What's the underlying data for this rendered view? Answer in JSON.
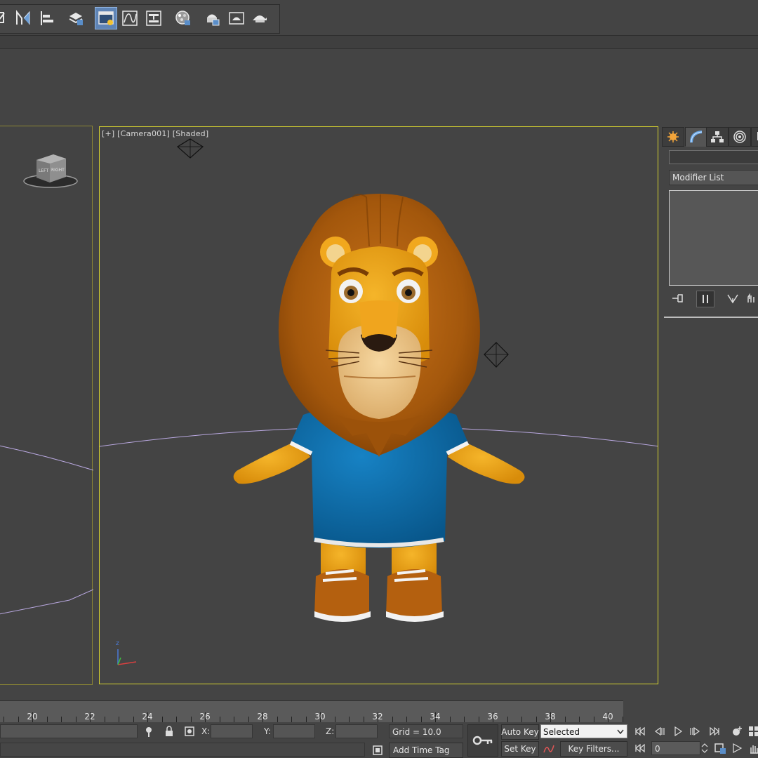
{
  "viewport": {
    "label": "[+] [Camera001] [Shaded]",
    "viewcube_left": "LEFT",
    "viewcube_right": "RIGHT"
  },
  "command_panel": {
    "tabs": [
      "create-icon",
      "modify-icon",
      "hierarchy-icon",
      "motion-icon",
      "display-icon"
    ],
    "modifier_list_label": "Modifier List"
  },
  "timeline": {
    "ticks": [
      "20",
      "22",
      "24",
      "26",
      "28",
      "30",
      "32",
      "34",
      "36",
      "38",
      "40"
    ]
  },
  "status_bar": {
    "x_label": "X:",
    "y_label": "Y:",
    "z_label": "Z:",
    "grid": "Grid = 10.0",
    "add_time_tag": "Add Time Tag",
    "auto_key": "Auto Key",
    "set_key": "Set Key",
    "selected": "Selected",
    "key_filters": "Key Filters...",
    "frame": "0"
  },
  "colors": {
    "active_viewport_border": "#d6d22f",
    "background": "#444444",
    "shirt": "#0d6aa5",
    "mane": "#a65a0c",
    "fur": "#e7a016"
  }
}
